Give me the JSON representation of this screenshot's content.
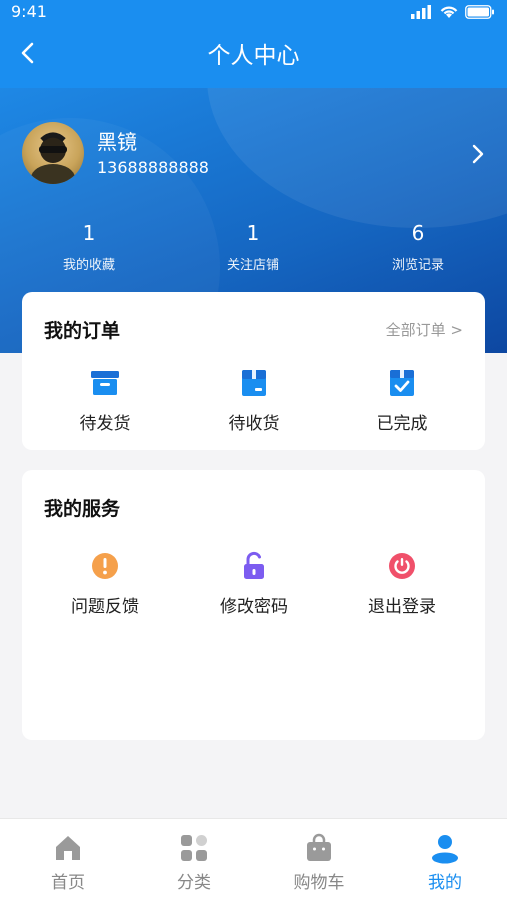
{
  "status_bar": {
    "time": "9:41"
  },
  "nav": {
    "title": "个人中心"
  },
  "profile": {
    "name": "黑镜",
    "phone": "13688888888"
  },
  "stats": [
    {
      "value": "1",
      "label": "我的收藏"
    },
    {
      "value": "1",
      "label": "关注店铺"
    },
    {
      "value": "6",
      "label": "浏览记录"
    }
  ],
  "orders": {
    "title": "我的订单",
    "all_label": "全部订单  >",
    "items": [
      {
        "label": "待发货",
        "icon": "box-icon"
      },
      {
        "label": "待收货",
        "icon": "package-icon"
      },
      {
        "label": "已完成",
        "icon": "check-box-icon"
      }
    ]
  },
  "services": {
    "title": "我的服务",
    "items": [
      {
        "label": "问题反馈",
        "icon": "alert-icon"
      },
      {
        "label": "修改密码",
        "icon": "unlock-icon"
      },
      {
        "label": "退出登录",
        "icon": "power-icon"
      }
    ]
  },
  "tabs": [
    {
      "label": "首页",
      "icon": "home-icon"
    },
    {
      "label": "分类",
      "icon": "category-icon"
    },
    {
      "label": "购物车",
      "icon": "cart-icon"
    },
    {
      "label": "我的",
      "icon": "user-icon"
    }
  ],
  "colors": {
    "primary": "#1a8ef0",
    "hero_dark": "#0d47a1",
    "tab_inactive": "#888888",
    "alert": "#f5a04b",
    "lock": "#7c5cf0",
    "power": "#f0506a"
  }
}
